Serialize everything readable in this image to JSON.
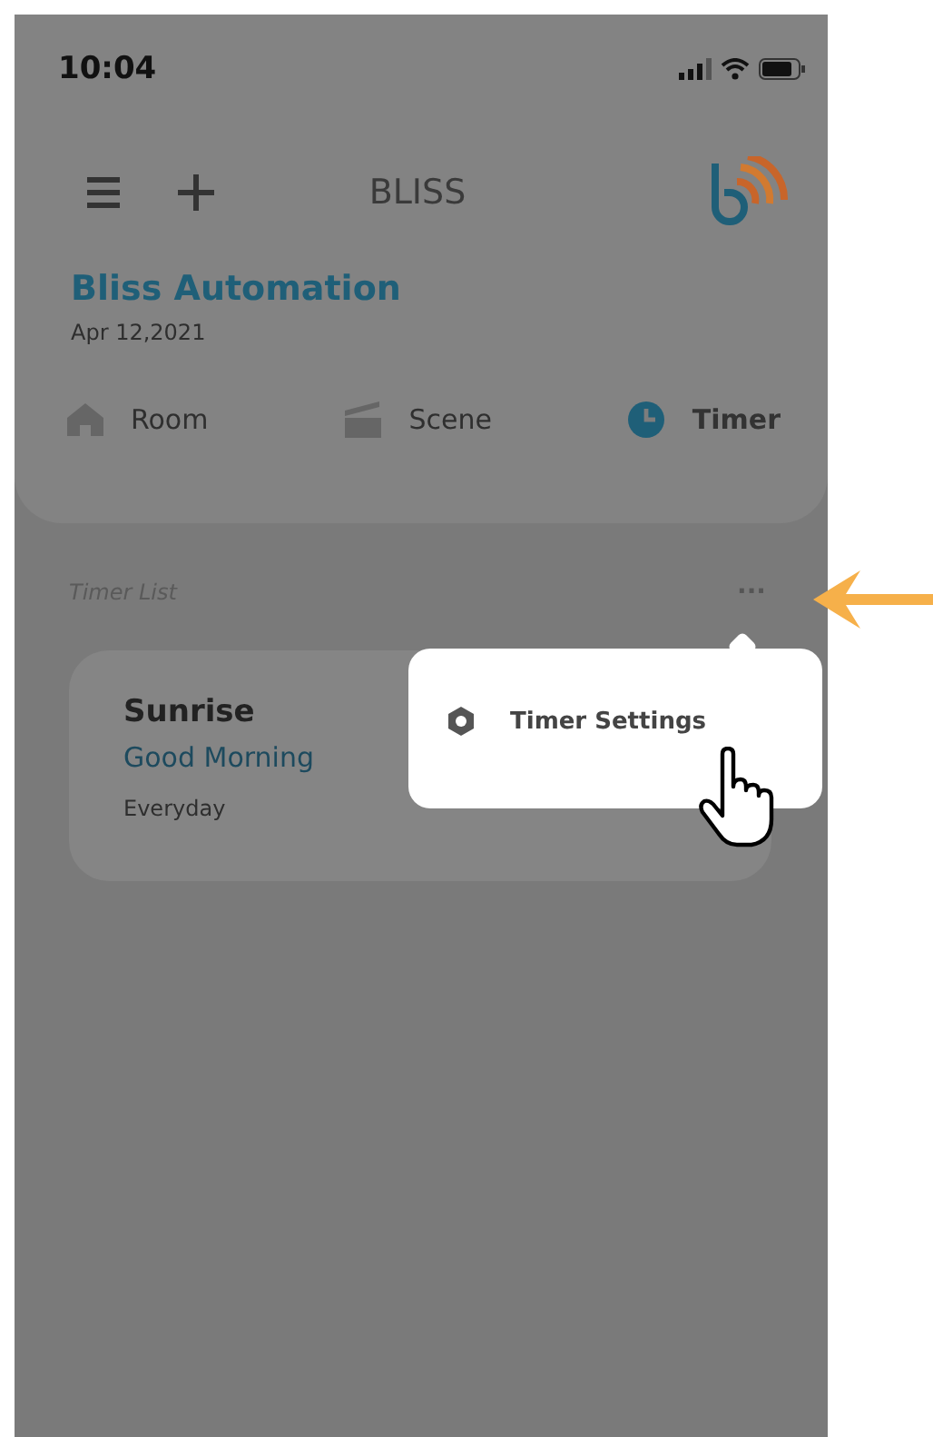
{
  "status_bar": {
    "time": "10:04"
  },
  "header": {
    "title": "BLISS"
  },
  "home": {
    "name": "Bliss Automation",
    "date": "Apr 12,2021"
  },
  "tabs": [
    {
      "label": "Room",
      "kind": "room",
      "selected": false
    },
    {
      "label": "Scene",
      "kind": "scene",
      "selected": false
    },
    {
      "label": "Timer",
      "kind": "timer",
      "selected": true
    }
  ],
  "timer_list": {
    "title": "Timer List",
    "more": "···",
    "timers": [
      {
        "name": "Sunrise",
        "subtitle": "Good Morning",
        "repeat": "Everyday"
      }
    ]
  },
  "menu": {
    "items": [
      {
        "label": "Timer Settings"
      }
    ]
  }
}
